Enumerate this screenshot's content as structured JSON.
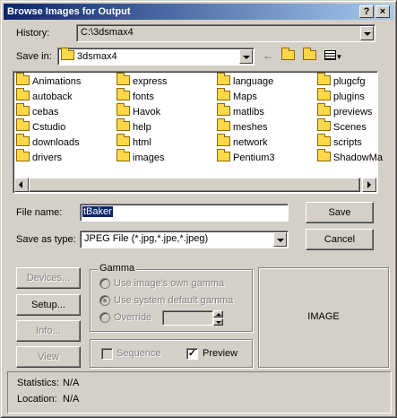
{
  "window": {
    "title": "Browse Images for Output",
    "help_label": "?",
    "close_label": "×"
  },
  "history": {
    "label": "History:",
    "value": "C:\\3dsmax4"
  },
  "save_in": {
    "label": "Save in:",
    "value": "3dsmax4"
  },
  "file_list": {
    "items": [
      "Animations",
      "autoback",
      "cebas",
      "Cstudio",
      "downloads",
      "drivers",
      "express",
      "fonts",
      "Havok",
      "help",
      "html",
      "images",
      "language",
      "Maps",
      "matlibs",
      "meshes",
      "network",
      "Pentium3",
      "plugcfg",
      "plugins",
      "previews",
      "Scenes",
      "scripts",
      "ShadowMa"
    ]
  },
  "file_name": {
    "label": "File name:",
    "value": "tBaker"
  },
  "save_as_type": {
    "label": "Save as type:",
    "value": "JPEG File (*.jpg,*.jpe,*.jpeg)"
  },
  "buttons": {
    "save": "Save",
    "cancel": "Cancel",
    "devices": "Devices...",
    "setup": "Setup...",
    "info": "Info...",
    "view": "View"
  },
  "gamma": {
    "title": "Gamma",
    "own_label": "Use image's own gamma",
    "default_label": "Use system default gamma",
    "override_label": "Override",
    "selected": "default"
  },
  "sequence": {
    "label": "Sequence",
    "checked": false
  },
  "preview": {
    "label": "Preview",
    "checked": true,
    "mark": "✓"
  },
  "image_preview": {
    "label": "IMAGE"
  },
  "statistics": {
    "label": "Statistics:",
    "value": "N/A"
  },
  "location": {
    "label": "Location:",
    "value": "N/A"
  }
}
